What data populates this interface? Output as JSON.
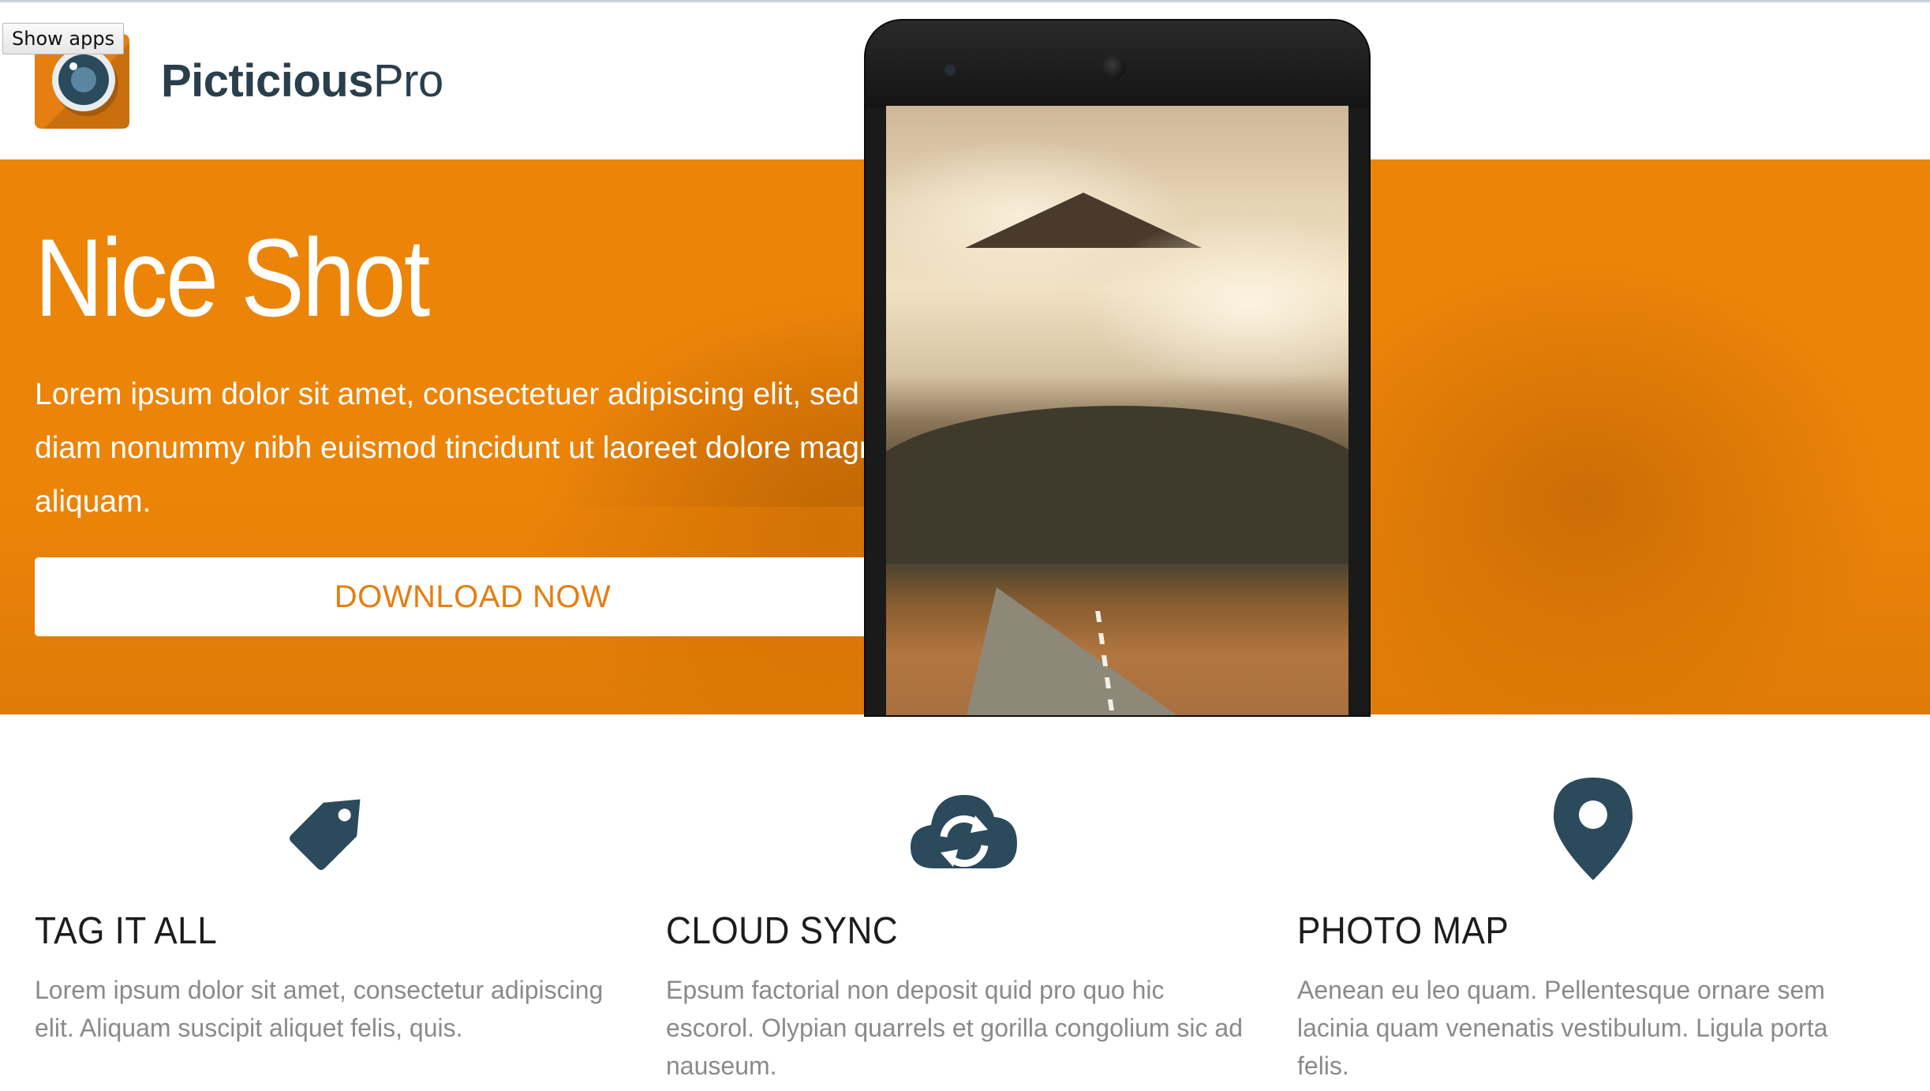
{
  "header": {
    "brand_bold": "Picticious",
    "brand_light": "Pro",
    "show_apps_label": "Show apps"
  },
  "hero": {
    "title": "Nice Shot",
    "lines": [
      "Lorem ipsum dolor sit amet, consectetuer adipiscing elit, sed",
      "diam nonummy nibh euismod tincidunt ut laoreet dolore magna",
      "aliquam."
    ],
    "cta_label": "DOWNLOAD NOW"
  },
  "features": [
    {
      "icon": "tag-icon",
      "title": "TAG IT ALL",
      "text": "Lorem ipsum dolor sit amet, consectetur adipiscing elit. Aliquam suscipit aliquet felis, quis."
    },
    {
      "icon": "cloud-sync-icon",
      "title": "CLOUD SYNC",
      "text": "Epsum factorial non deposit quid pro quo hic escorol. Olypian quarrels et gorilla congolium sic ad nauseum."
    },
    {
      "icon": "map-pin-icon",
      "title": "PHOTO MAP",
      "text": "Aenean eu leo quam. Pellentesque ornare sem lacinia quam venenatis vestibulum. Ligula porta felis."
    }
  ],
  "colors": {
    "accent": "#ec8408",
    "brand_text": "#2a3e4c",
    "icon": "#2b4a5c",
    "body_text": "#8a8a8a"
  }
}
